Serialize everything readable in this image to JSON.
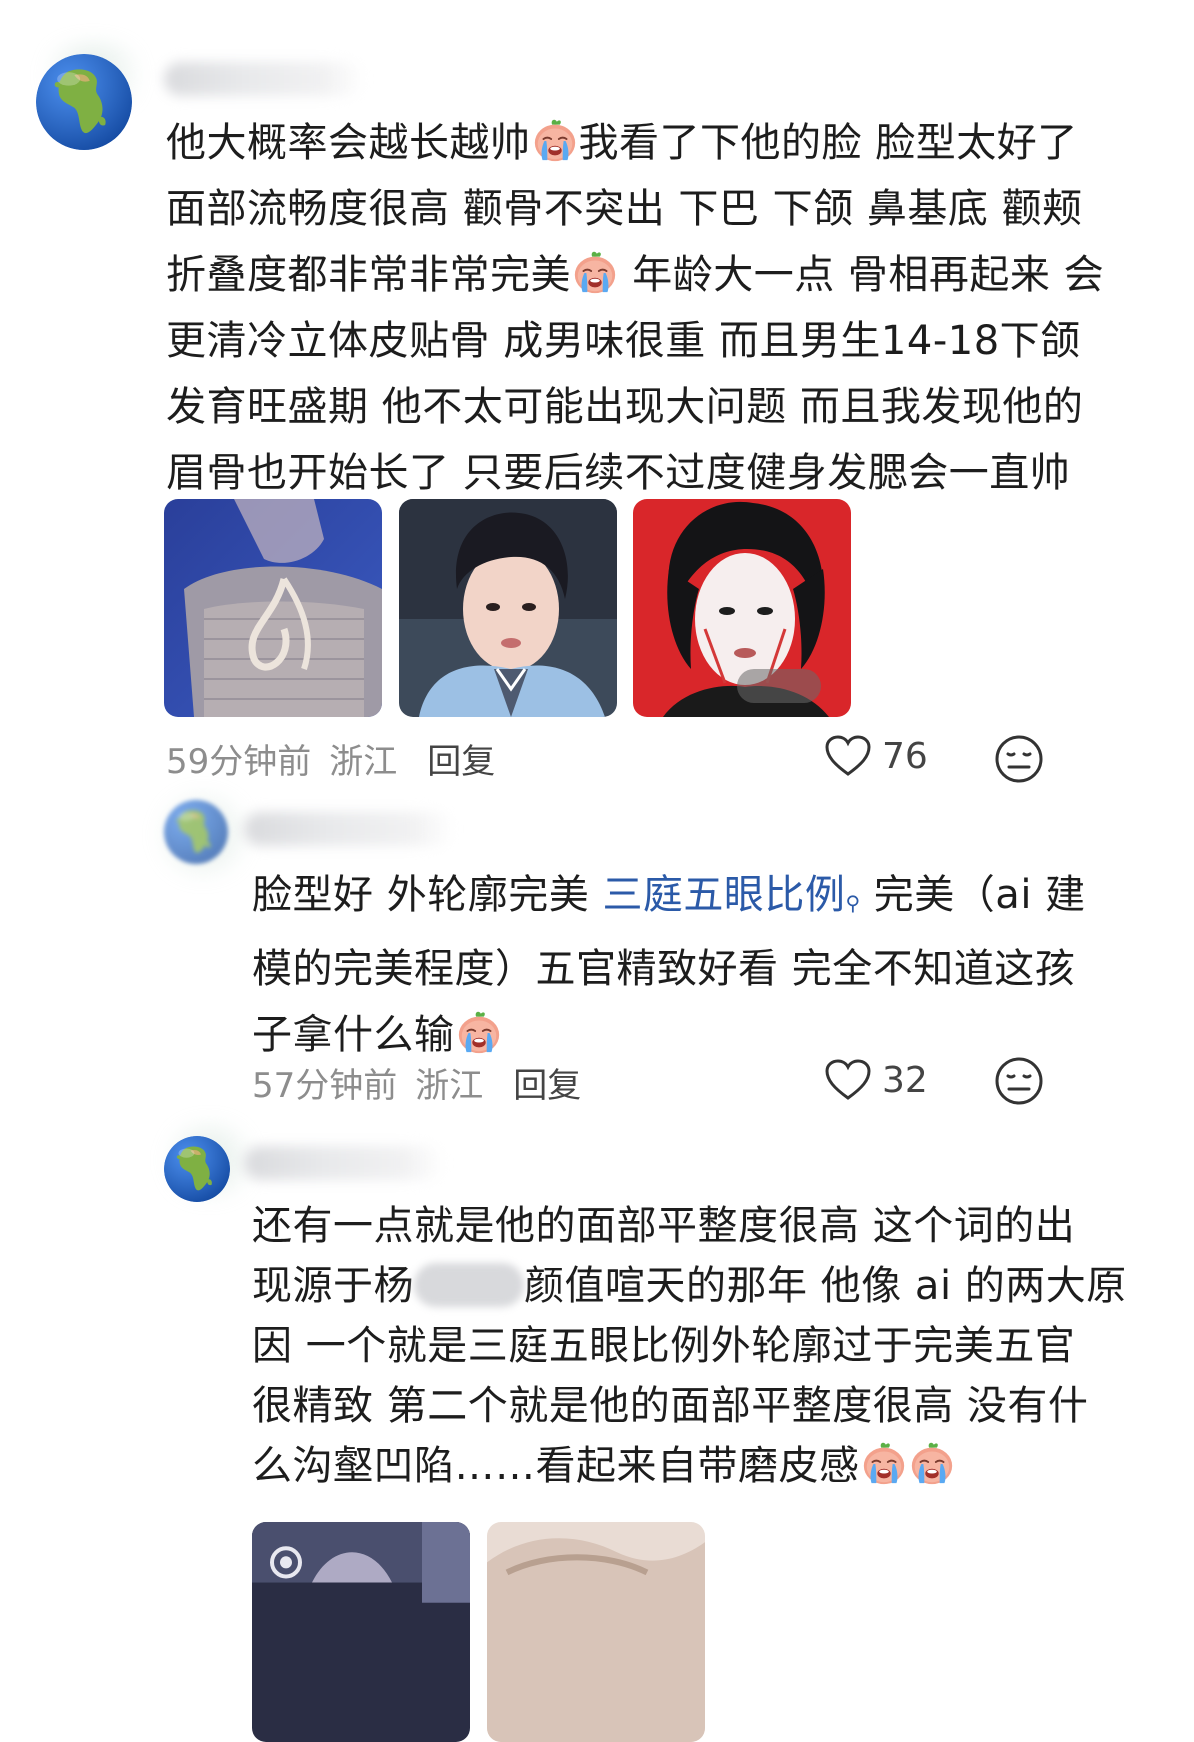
{
  "comments": [
    {
      "lines": [
        "他大概率会越长越帅",
        "我看了下他的脸 脸型太好了",
        "面部流畅度很高 颧骨不突出 下巴 下颌 鼻基底 颧颊",
        "折叠度都非常非常完美",
        " 年龄大一点 骨相再起来 会",
        "更清冷立体皮贴骨 成男味很重 而且男生14-18下颌",
        "发育旺盛期 他不太可能出现大问题 而且我发现他的",
        "眉骨也开始长了 只要后续不过度健身发腮会一直帅"
      ],
      "time": "59分钟前",
      "location": "浙江",
      "reply": "回复",
      "likes": "76"
    },
    {
      "seg1": "脸型好 外轮廓完美 ",
      "link": "三庭五眼比例",
      "seg2": " 完美（ai 建",
      "line2": "模的完美程度）五官精致好看 完全不知道这孩",
      "line3": "子拿什么输",
      "time": "57分钟前",
      "location": "浙江",
      "reply": "回复",
      "likes": "32"
    },
    {
      "line1": "还有一点就是他的面部平整度很高 这个词的出",
      "line2a": "现源于杨",
      "line2b": "颜值喧天的那年 他像 ai 的两大原",
      "line3": "因 一个就是三庭五眼比例外轮廓过于完美五官",
      "line4": "很精致 第二个就是他的面部平整度很高 没有什",
      "line5": "么沟壑凹陷……看起来自带磨皮感"
    }
  ],
  "icons": {
    "avatar": "earth-globe-africa-icon",
    "emoji": "loudly-crying-face-icon",
    "like": "heart-outline-icon",
    "dislike": "expressionless-face-icon",
    "search": "search-icon"
  },
  "colors": {
    "link": "#2b5aa8",
    "meta": "#8d8d8d",
    "text": "#1d1d1d"
  }
}
